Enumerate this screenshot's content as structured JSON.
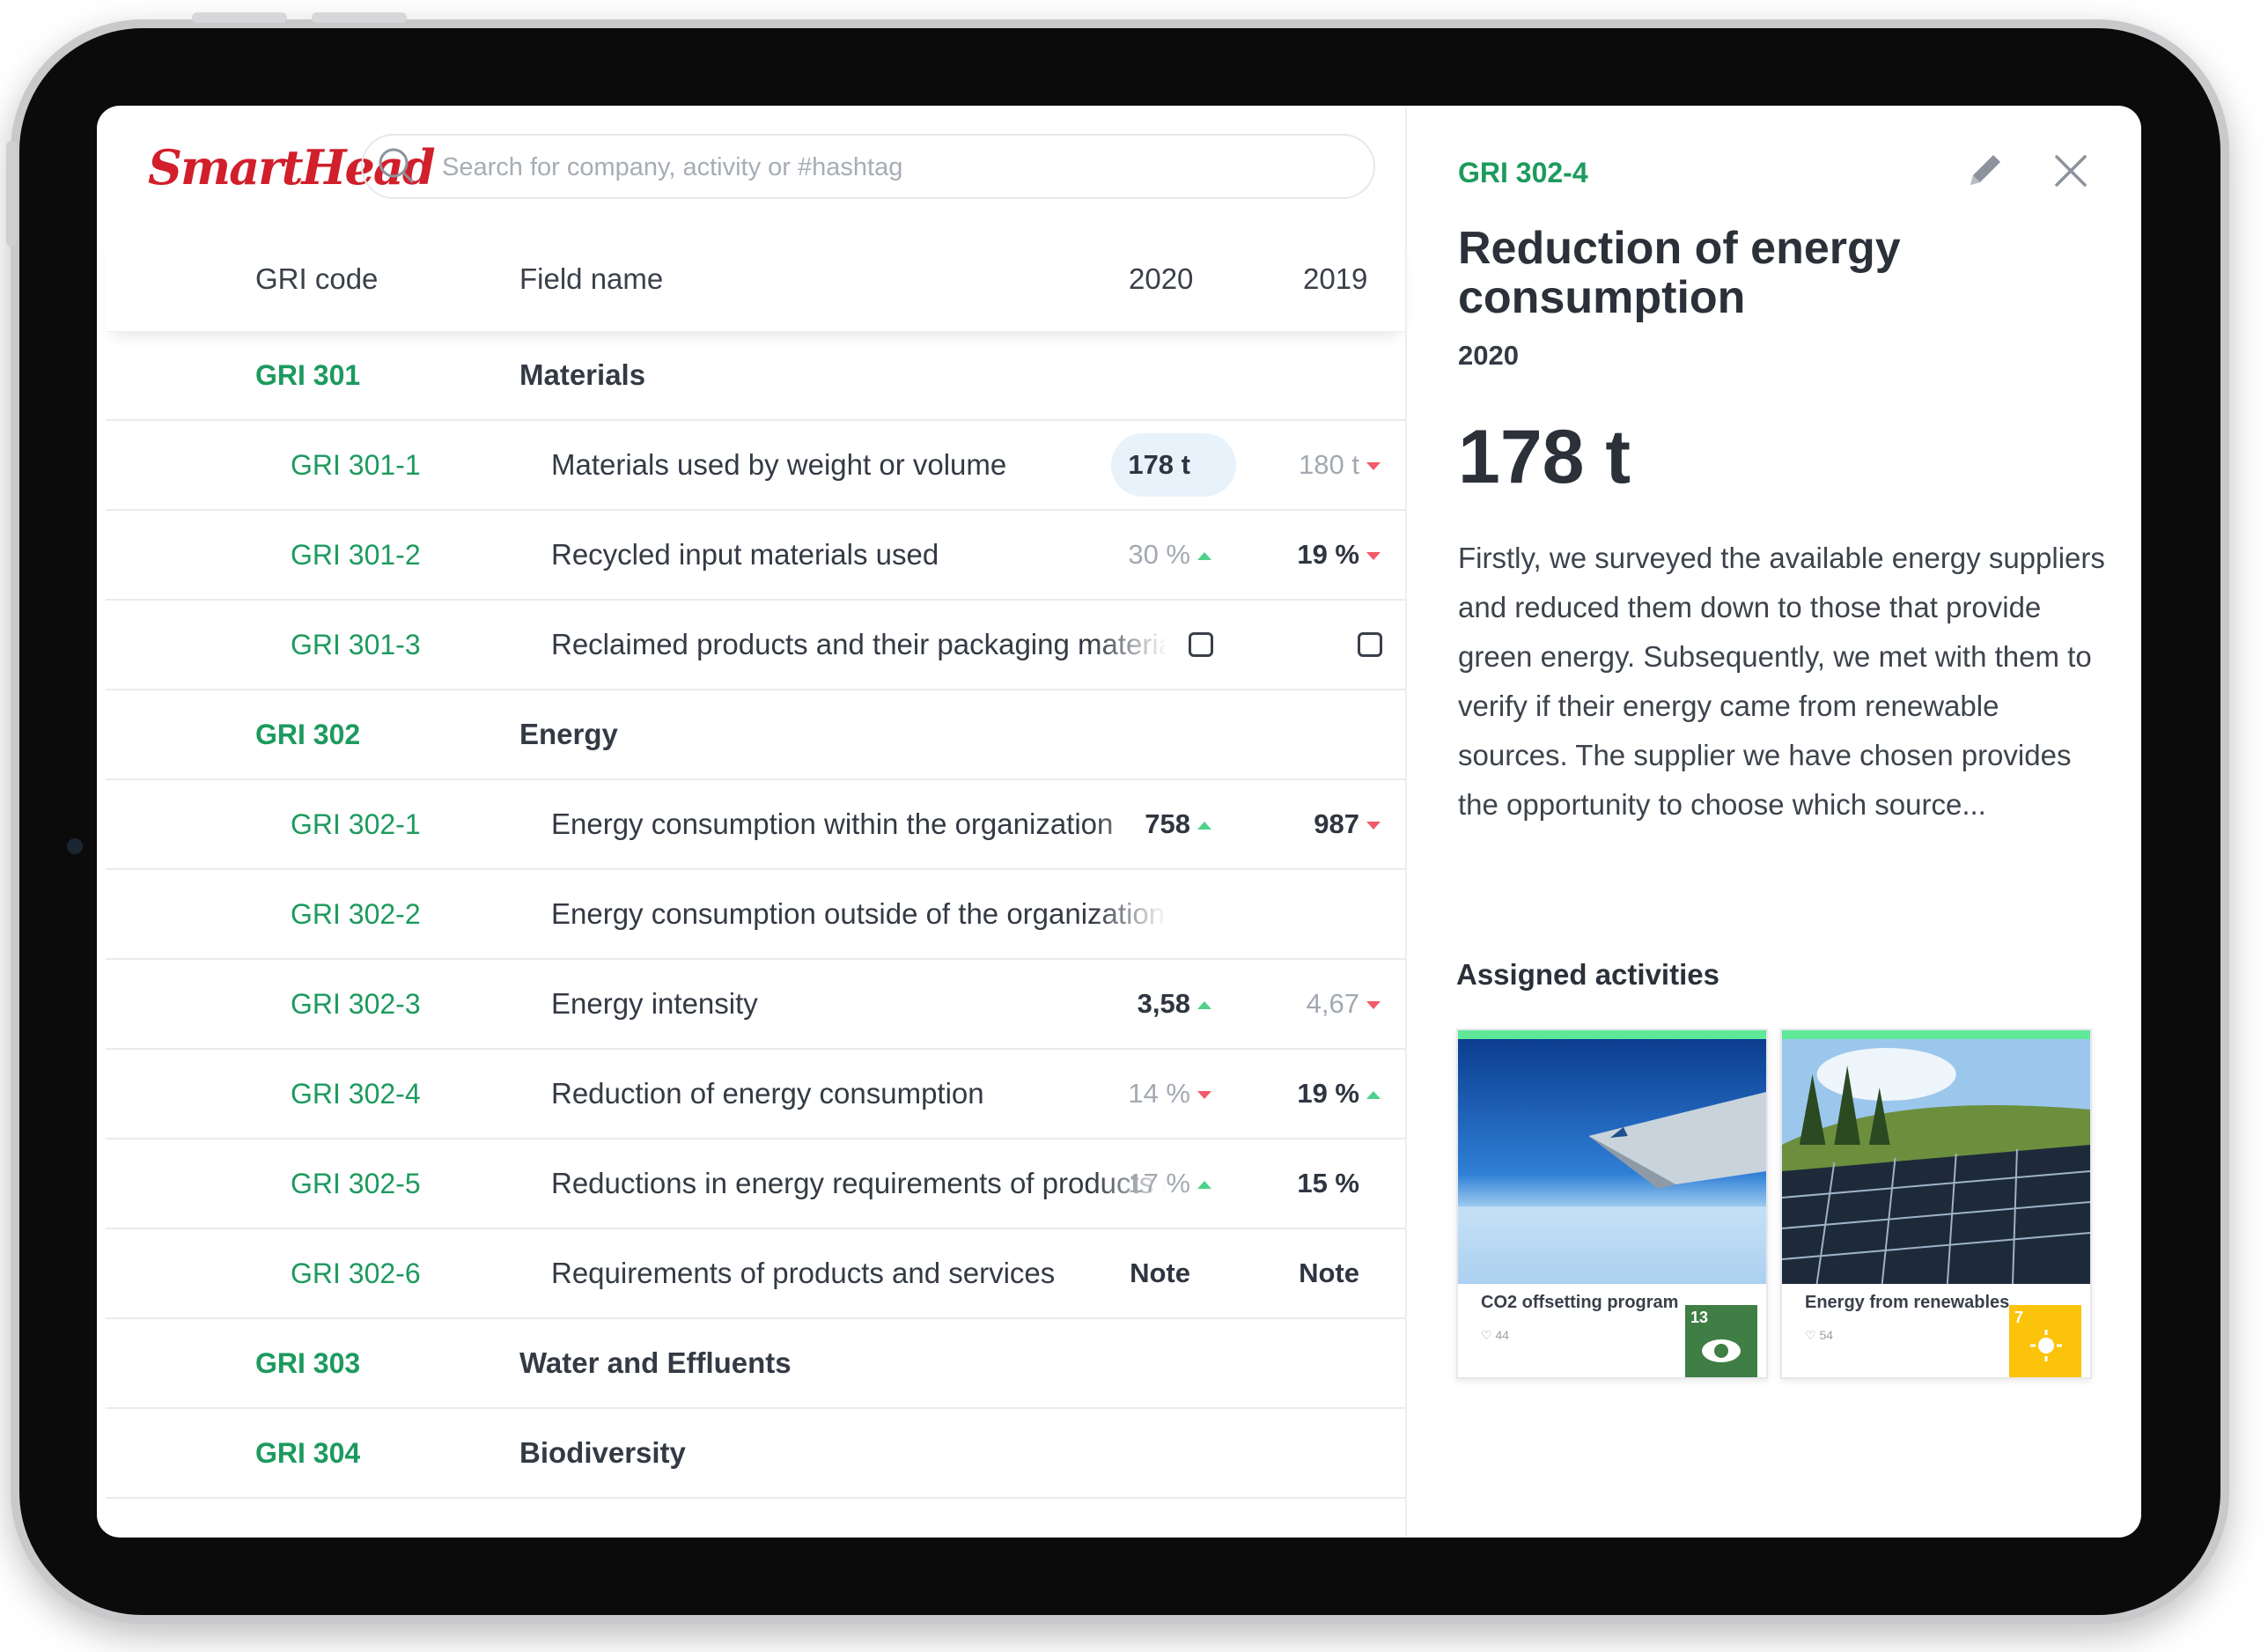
{
  "header": {
    "logo": "SmartHead",
    "search_placeholder": "Search for company, activity or #hashtag"
  },
  "table": {
    "columns": [
      "GRI code",
      "Field name",
      "2020",
      "2019"
    ],
    "rows": [
      {
        "code": "GRI 301",
        "name": "Materials",
        "group": true
      },
      {
        "code": "GRI 301-1",
        "name": "Materials used by weight or volume",
        "v2020": "178 t",
        "v2019": "180 t",
        "t2019": "down"
      },
      {
        "code": "GRI 301-2",
        "name": "Recycled input materials used",
        "v2020": "30 %",
        "t2020": "up",
        "v2019": "19 %",
        "t2019": "down"
      },
      {
        "code": "GRI 301-3",
        "name": "Reclaimed products and their packaging materials",
        "v2020_checkbox": true,
        "v2019_checkbox": true
      },
      {
        "code": "GRI 302",
        "name": "Energy",
        "group": true
      },
      {
        "code": "GRI 302-1",
        "name": "Energy consumption within the organization",
        "v2020": "758",
        "t2020": "up",
        "v2019": "987",
        "t2019": "down"
      },
      {
        "code": "GRI 302-2",
        "name": "Energy consumption outside of the organization"
      },
      {
        "code": "GRI 302-3",
        "name": "Energy intensity",
        "v2020": "3,58",
        "t2020": "up",
        "v2019": "4,67",
        "t2019": "down"
      },
      {
        "code": "GRI 302-4",
        "name": "Reduction of energy consumption",
        "v2020": "14 %",
        "t2020": "down",
        "v2019": "19 %",
        "t2019": "up"
      },
      {
        "code": "GRI 302-5",
        "name": "Reductions in energy requirements of products and services",
        "v2020": "17 %",
        "t2020": "up",
        "v2019": "15 %"
      },
      {
        "code": "GRI 302-6",
        "name": "Requirements of products and services",
        "v2020": "Note",
        "v2019": "Note"
      },
      {
        "code": "GRI 303",
        "name": "Water and Effluents",
        "group": true
      },
      {
        "code": "GRI 304",
        "name": "Biodiversity",
        "group": true
      }
    ]
  },
  "detail": {
    "code": "GRI 302-4",
    "title": "Reduction of energy consumption",
    "year": "2020",
    "value": "178 t",
    "description": "Firstly, we surveyed the available energy suppliers and reduced them down to those that provide green energy. Subsequently, we met with them to verify if their energy came from renewable sources. The supplier we have chosen provides the opportunity to choose which source...",
    "activities_title": "Assigned activities",
    "activities": [
      {
        "name": "CO2 offsetting program",
        "likes": "44",
        "sdg": "13"
      },
      {
        "name": "Energy from renewables",
        "likes": "54",
        "sdg": "7"
      }
    ]
  },
  "colors": {
    "accent_green": "#1d9a5e",
    "brand_red": "#d11f2b",
    "trend_up": "#4fd18b",
    "trend_down": "#f25a68",
    "highlight": "#e8f2fb"
  },
  "icons": [
    "search-icon",
    "edit-icon",
    "close-icon",
    "trend-up-icon",
    "trend-down-icon",
    "heart-icon"
  ]
}
